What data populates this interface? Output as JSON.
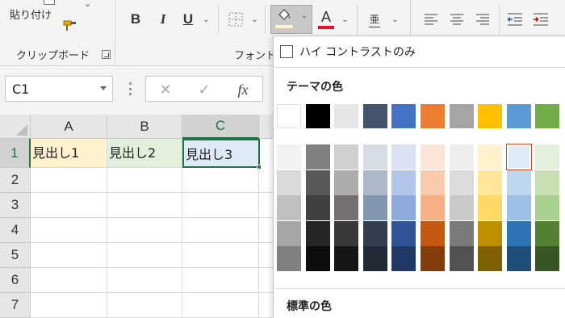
{
  "ribbon": {
    "clipboard": {
      "paste_label": "貼り付け",
      "group_label": "クリップボード"
    },
    "font": {
      "group_label": "フォント",
      "bold_label": "B",
      "italic_label": "I",
      "underline_label": "U",
      "font_color_label": "A",
      "fill_color": "#fff2cc",
      "font_color": "#e81123",
      "phonetic_label": "亜"
    }
  },
  "formula_bar": {
    "name_box": "C1",
    "fx_label": "fx",
    "cancel_symbol": "✕",
    "enter_symbol": "✓"
  },
  "sheet": {
    "columns": [
      "A",
      "B",
      "C"
    ],
    "rows": [
      "1",
      "2",
      "3",
      "4",
      "5",
      "6",
      "7"
    ],
    "selected_column": "C",
    "selected_row": "1",
    "cells": {
      "A1": {
        "value": "見出し1",
        "fill": "#fff2cc"
      },
      "B1": {
        "value": "見出し2",
        "fill": "#e2efda"
      },
      "C1": {
        "value": "見出し3",
        "fill": "#deebf7"
      }
    }
  },
  "color_panel": {
    "high_contrast_label": "ハイ コントラストのみ",
    "theme_title": "テーマの色",
    "standard_title": "標準の色",
    "theme_colors": [
      "#ffffff",
      "#000000",
      "#e7e6e6",
      "#44546a",
      "#4472c4",
      "#ed7d31",
      "#a5a5a5",
      "#ffc000",
      "#5b9bd5",
      "#70ad47"
    ],
    "shades": [
      [
        "#f2f2f2",
        "#d9d9d9",
        "#bfbfbf",
        "#a6a6a6",
        "#808080"
      ],
      [
        "#808080",
        "#595959",
        "#404040",
        "#262626",
        "#0d0d0d"
      ],
      [
        "#d0cece",
        "#aeabab",
        "#757171",
        "#3a3838",
        "#171616"
      ],
      [
        "#d6dce4",
        "#adb9ca",
        "#8497b0",
        "#333f4f",
        "#222b35"
      ],
      [
        "#d9e1f2",
        "#b4c6e7",
        "#8ea9db",
        "#2f5597",
        "#1f3864"
      ],
      [
        "#fce4d6",
        "#f8cbad",
        "#f4b084",
        "#c65911",
        "#833c0b"
      ],
      [
        "#ededed",
        "#dbdbdb",
        "#c9c9c9",
        "#7b7b7b",
        "#525252"
      ],
      [
        "#fff2cc",
        "#ffe699",
        "#ffd966",
        "#bf8f00",
        "#7f6000"
      ],
      [
        "#ddebf7",
        "#bdd7ee",
        "#9bc2e6",
        "#2e75b6",
        "#1f4e78"
      ],
      [
        "#e2efda",
        "#c6e0b4",
        "#a9d08e",
        "#548235",
        "#375623"
      ]
    ],
    "selected": "#ddebf7"
  }
}
